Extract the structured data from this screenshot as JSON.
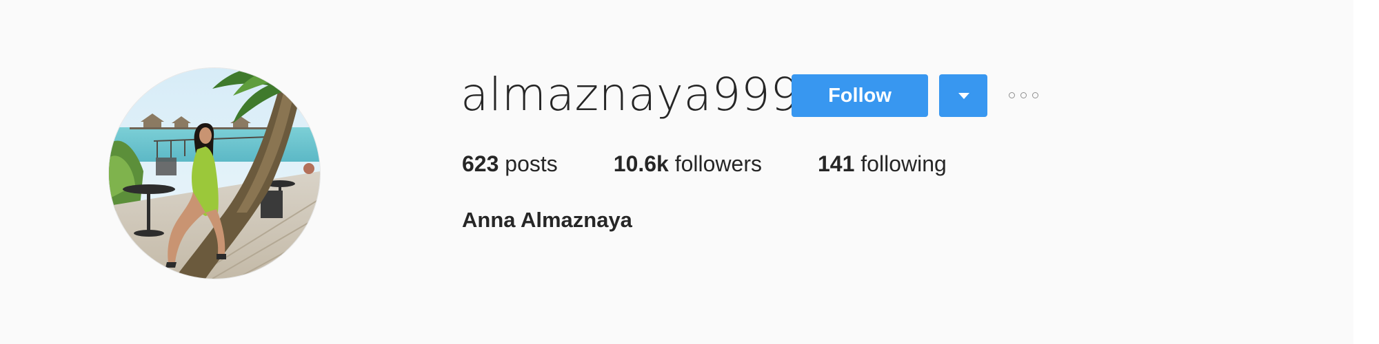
{
  "profile": {
    "username": "almaznaya999",
    "full_name": "Anna Almaznaya",
    "avatar_icon": "profile-photo-beach-palm"
  },
  "actions": {
    "follow_label": "Follow",
    "dropdown_icon": "caret-down-icon",
    "more_icon": "ellipsis-icon"
  },
  "stats": {
    "posts": {
      "count": "623",
      "label": "posts"
    },
    "followers": {
      "count": "10.6k",
      "label": "followers"
    },
    "following": {
      "count": "141",
      "label": "following"
    }
  },
  "colors": {
    "accent": "#3897f0",
    "background": "#fafafa",
    "text": "#262626",
    "muted": "#8e8e8e"
  }
}
